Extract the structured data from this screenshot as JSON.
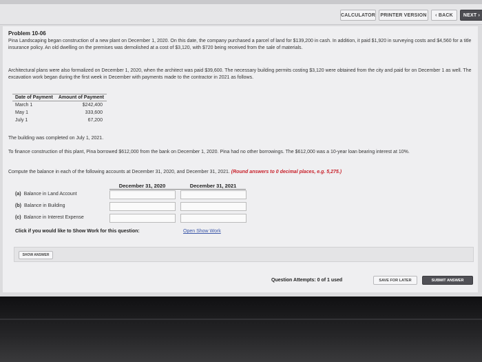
{
  "toolbar": {
    "calculator": "CALCULATOR",
    "printer_version": "PRINTER VERSION",
    "back": "‹ BACK",
    "next": "NEXT ›"
  },
  "problem": {
    "title": "Problem 10-06",
    "para1": "Pina Landscaping began construction of a new plant on December 1, 2020. On this date, the company purchased a parcel of land for $139,200 in cash. In addition, it paid $1,920 in surveying costs and $4,560 for a title insurance policy. An old dwelling on the premises was demolished at a cost of $3,120, with $720 being received from the sale of materials.",
    "para2": "Architectural plans were also formalized on December 1, 2020, when the architect was paid $39,600. The necessary building permits costing $3,120 were obtained from the city and paid for on December 1 as well. The excavation work began during the first week in December with payments made to the contractor in 2021 as follows.",
    "para3": "The building was completed on July 1, 2021.",
    "para4": "To finance construction of this plant, Pina borrowed $612,000 from the bank on December 1, 2020. Pina had no other borrowings. The $612,000 was a 10-year loan bearing interest at 10%.",
    "instruction": "Compute the balance in each of the following accounts at December 31, 2020, and December 31, 2021.",
    "rounding_note": "(Round answers to 0 decimal places, e.g. 5,275.)"
  },
  "payments_table": {
    "headers": [
      "Date of Payment",
      "Amount of Payment"
    ],
    "rows": [
      {
        "date": "March 1",
        "amount": "$242,400"
      },
      {
        "date": "May 1",
        "amount": "333,600"
      },
      {
        "date": "July 1",
        "amount": "67,200"
      }
    ]
  },
  "answers": {
    "col_2020": "December 31, 2020",
    "col_2021": "December 31, 2021",
    "rows": [
      {
        "tag": "(a)",
        "label": "Balance in Land Account"
      },
      {
        "tag": "(b)",
        "label": "Balance in Building"
      },
      {
        "tag": "(c)",
        "label": "Balance in Interest Expense"
      }
    ]
  },
  "show_work": {
    "prompt": "Click if you would like to Show Work for this question:",
    "link": "Open Show Work"
  },
  "buttons": {
    "show_answer": "SHOW ANSWER",
    "save_for_later": "SAVE FOR LATER",
    "submit_answer": "SUBMIT ANSWER"
  },
  "attempts": "Question Attempts: 0 of 1 used"
}
